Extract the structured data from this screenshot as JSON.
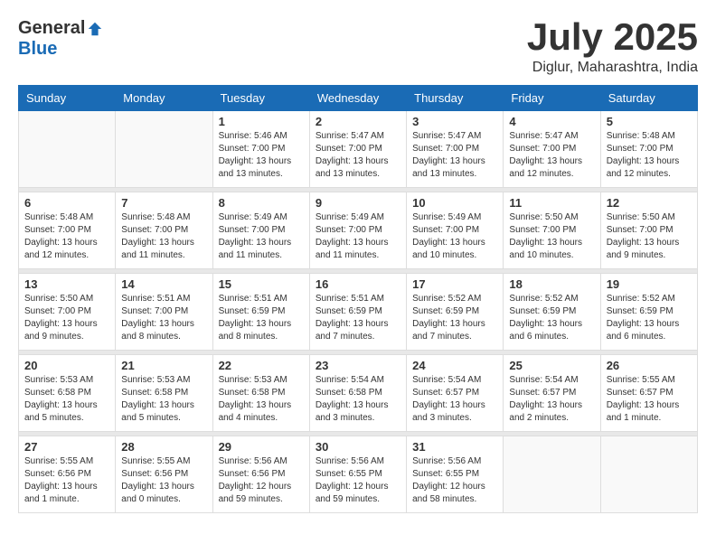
{
  "logo": {
    "general": "General",
    "blue": "Blue"
  },
  "title": "July 2025",
  "location": "Diglur, Maharashtra, India",
  "days_of_week": [
    "Sunday",
    "Monday",
    "Tuesday",
    "Wednesday",
    "Thursday",
    "Friday",
    "Saturday"
  ],
  "weeks": [
    [
      {
        "day": "",
        "info": ""
      },
      {
        "day": "",
        "info": ""
      },
      {
        "day": "1",
        "info": "Sunrise: 5:46 AM\nSunset: 7:00 PM\nDaylight: 13 hours\nand 13 minutes."
      },
      {
        "day": "2",
        "info": "Sunrise: 5:47 AM\nSunset: 7:00 PM\nDaylight: 13 hours\nand 13 minutes."
      },
      {
        "day": "3",
        "info": "Sunrise: 5:47 AM\nSunset: 7:00 PM\nDaylight: 13 hours\nand 13 minutes."
      },
      {
        "day": "4",
        "info": "Sunrise: 5:47 AM\nSunset: 7:00 PM\nDaylight: 13 hours\nand 12 minutes."
      },
      {
        "day": "5",
        "info": "Sunrise: 5:48 AM\nSunset: 7:00 PM\nDaylight: 13 hours\nand 12 minutes."
      }
    ],
    [
      {
        "day": "6",
        "info": "Sunrise: 5:48 AM\nSunset: 7:00 PM\nDaylight: 13 hours\nand 12 minutes."
      },
      {
        "day": "7",
        "info": "Sunrise: 5:48 AM\nSunset: 7:00 PM\nDaylight: 13 hours\nand 11 minutes."
      },
      {
        "day": "8",
        "info": "Sunrise: 5:49 AM\nSunset: 7:00 PM\nDaylight: 13 hours\nand 11 minutes."
      },
      {
        "day": "9",
        "info": "Sunrise: 5:49 AM\nSunset: 7:00 PM\nDaylight: 13 hours\nand 11 minutes."
      },
      {
        "day": "10",
        "info": "Sunrise: 5:49 AM\nSunset: 7:00 PM\nDaylight: 13 hours\nand 10 minutes."
      },
      {
        "day": "11",
        "info": "Sunrise: 5:50 AM\nSunset: 7:00 PM\nDaylight: 13 hours\nand 10 minutes."
      },
      {
        "day": "12",
        "info": "Sunrise: 5:50 AM\nSunset: 7:00 PM\nDaylight: 13 hours\nand 9 minutes."
      }
    ],
    [
      {
        "day": "13",
        "info": "Sunrise: 5:50 AM\nSunset: 7:00 PM\nDaylight: 13 hours\nand 9 minutes."
      },
      {
        "day": "14",
        "info": "Sunrise: 5:51 AM\nSunset: 7:00 PM\nDaylight: 13 hours\nand 8 minutes."
      },
      {
        "day": "15",
        "info": "Sunrise: 5:51 AM\nSunset: 6:59 PM\nDaylight: 13 hours\nand 8 minutes."
      },
      {
        "day": "16",
        "info": "Sunrise: 5:51 AM\nSunset: 6:59 PM\nDaylight: 13 hours\nand 7 minutes."
      },
      {
        "day": "17",
        "info": "Sunrise: 5:52 AM\nSunset: 6:59 PM\nDaylight: 13 hours\nand 7 minutes."
      },
      {
        "day": "18",
        "info": "Sunrise: 5:52 AM\nSunset: 6:59 PM\nDaylight: 13 hours\nand 6 minutes."
      },
      {
        "day": "19",
        "info": "Sunrise: 5:52 AM\nSunset: 6:59 PM\nDaylight: 13 hours\nand 6 minutes."
      }
    ],
    [
      {
        "day": "20",
        "info": "Sunrise: 5:53 AM\nSunset: 6:58 PM\nDaylight: 13 hours\nand 5 minutes."
      },
      {
        "day": "21",
        "info": "Sunrise: 5:53 AM\nSunset: 6:58 PM\nDaylight: 13 hours\nand 5 minutes."
      },
      {
        "day": "22",
        "info": "Sunrise: 5:53 AM\nSunset: 6:58 PM\nDaylight: 13 hours\nand 4 minutes."
      },
      {
        "day": "23",
        "info": "Sunrise: 5:54 AM\nSunset: 6:58 PM\nDaylight: 13 hours\nand 3 minutes."
      },
      {
        "day": "24",
        "info": "Sunrise: 5:54 AM\nSunset: 6:57 PM\nDaylight: 13 hours\nand 3 minutes."
      },
      {
        "day": "25",
        "info": "Sunrise: 5:54 AM\nSunset: 6:57 PM\nDaylight: 13 hours\nand 2 minutes."
      },
      {
        "day": "26",
        "info": "Sunrise: 5:55 AM\nSunset: 6:57 PM\nDaylight: 13 hours\nand 1 minute."
      }
    ],
    [
      {
        "day": "27",
        "info": "Sunrise: 5:55 AM\nSunset: 6:56 PM\nDaylight: 13 hours\nand 1 minute."
      },
      {
        "day": "28",
        "info": "Sunrise: 5:55 AM\nSunset: 6:56 PM\nDaylight: 13 hours\nand 0 minutes."
      },
      {
        "day": "29",
        "info": "Sunrise: 5:56 AM\nSunset: 6:56 PM\nDaylight: 12 hours\nand 59 minutes."
      },
      {
        "day": "30",
        "info": "Sunrise: 5:56 AM\nSunset: 6:55 PM\nDaylight: 12 hours\nand 59 minutes."
      },
      {
        "day": "31",
        "info": "Sunrise: 5:56 AM\nSunset: 6:55 PM\nDaylight: 12 hours\nand 58 minutes."
      },
      {
        "day": "",
        "info": ""
      },
      {
        "day": "",
        "info": ""
      }
    ]
  ]
}
